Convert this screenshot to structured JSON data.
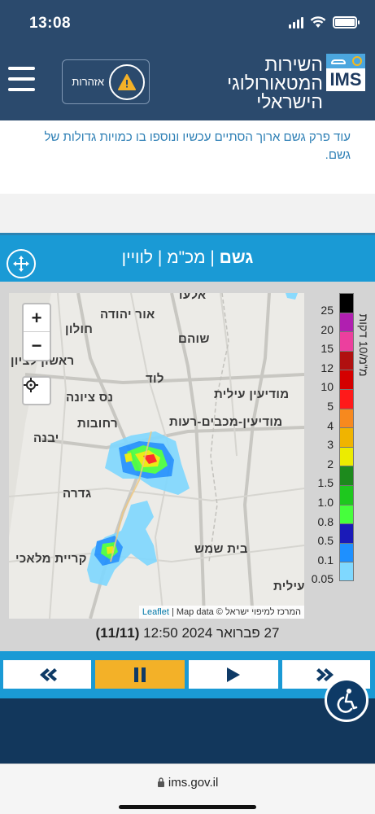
{
  "status_bar": {
    "time": "13:08"
  },
  "header": {
    "warnings_label": "אזהרות",
    "title_lines": [
      "השירות",
      "המטאורולוגי",
      "הישראלי"
    ],
    "logo_text": "IMS"
  },
  "message": "עוד פרק גשם ארוך הסתיים עכשיו ונוספו בו כמויות גדולות של גשם.",
  "rain_bar": {
    "active": "גשם",
    "sep1": " | ",
    "option2": "מכ\"מ",
    "sep2": " | ",
    "option3": "לוויין"
  },
  "map": {
    "zoom_in": "+",
    "zoom_out": "−",
    "cities": {
      "elad": "אלעד",
      "or_yehuda": "אור יהודה",
      "holon": "חולון",
      "shoham": "שוהם",
      "rishon": "ראשון לציון",
      "lod": "לוד",
      "ness_ziona": "נס ציונה",
      "modiin_illit": "מודיעין עילית",
      "rehovot": "רחובות",
      "modiin": "מודיעין-מכבים-רעות",
      "yavne": "יבנה",
      "gedera": "גדרה",
      "beit_shemesh": "בית שמש",
      "kiryat_malachi": "קריית מלאכי",
      "beitar_illit": "ביתר עילית"
    },
    "attribution": {
      "leaflet": "Leaflet",
      "sep": " | Map data © ",
      "provider": "המרכז למיפוי ישראל"
    }
  },
  "legend": {
    "unit": "מ\"מ/10 דקות",
    "ticks": [
      "25",
      "20",
      "15",
      "12",
      "10",
      "5",
      "4",
      "3",
      "2",
      "1.5",
      "1.0",
      "0.8",
      "0.5",
      "0.1",
      "0.05"
    ],
    "colors": [
      "#000000",
      "#b01fb0",
      "#ec3f9e",
      "#b01010",
      "#d40000",
      "#ff1a1a",
      "#f7891e",
      "#f0b400",
      "#ecec00",
      "#1d8a1d",
      "#1ec81e",
      "#46ff3c",
      "#1a1ab8",
      "#1e90ff",
      "#7fd8ff"
    ]
  },
  "timestamp": {
    "date": "27 פברואר 2024 12:50",
    "frame": "(11/11)"
  },
  "player": {
    "rewind_icon": "rewind-icon",
    "pause_icon": "pause-icon",
    "play_icon": "play-icon",
    "forward_icon": "fast-forward-icon"
  },
  "browser": {
    "url": "ims.gov.il"
  }
}
